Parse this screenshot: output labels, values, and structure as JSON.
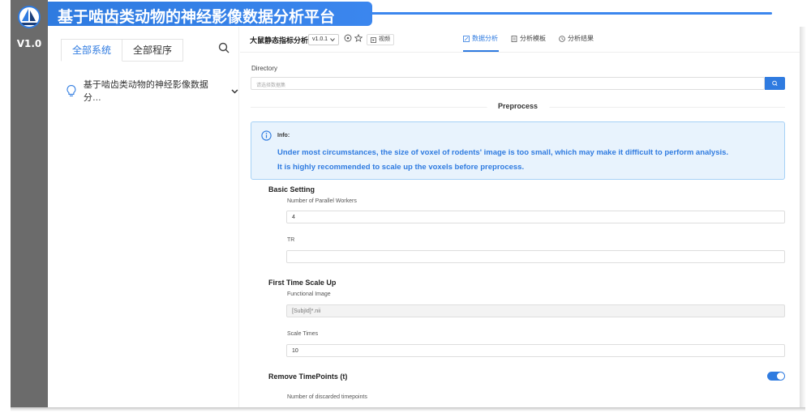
{
  "app": {
    "version_badge": "V1.0",
    "title": "基于啮齿类动物的神经影像数据分析平台"
  },
  "sidebar": {
    "tabs": [
      {
        "label": "全部系统",
        "active": true
      },
      {
        "label": "全部程序",
        "active": false
      }
    ],
    "tree": [
      {
        "label": "基于啮齿类动物的神经影像数据分…",
        "icon": "lightbulb-icon",
        "expanded": true
      }
    ]
  },
  "topbar": {
    "app_name": "大鼠静态指标分析",
    "version": "v1.0.1",
    "video_label": "视频",
    "nav_tabs": [
      {
        "label": "数据分析",
        "active": true,
        "icon": "edit-icon"
      },
      {
        "label": "分析模板",
        "active": false,
        "icon": "template-icon"
      },
      {
        "label": "分析结果",
        "active": false,
        "icon": "clock-icon"
      }
    ]
  },
  "directory": {
    "label": "Directory",
    "placeholder": "请选择数据集"
  },
  "preprocess": {
    "title": "Preprocess",
    "alert": {
      "label": "Info:",
      "line1": "Under most circumstances, the size of voxel of rodents' image is too small, which may make it difficult to perform analysis.",
      "line2": "It is highly recommended to scale up the voxels before preprocess."
    }
  },
  "basic_setting": {
    "title": "Basic Setting",
    "workers_label": "Number of Parallel Workers",
    "workers_value": "4",
    "tr_label": "TR",
    "tr_value": ""
  },
  "scale_up": {
    "title": "First Time Scale Up",
    "func_label": "Functional Image",
    "func_value": "[SubjId]*.nii",
    "times_label": "Scale Times",
    "times_value": "10"
  },
  "remove_timepoints": {
    "title": "Remove TimePoints (t)",
    "enabled": true,
    "discard_label": "Number of discarded timepoints"
  },
  "colors": {
    "primary": "#2f7be0",
    "rail": "#6b6b6b",
    "alert_bg": "#e8f3fd"
  }
}
